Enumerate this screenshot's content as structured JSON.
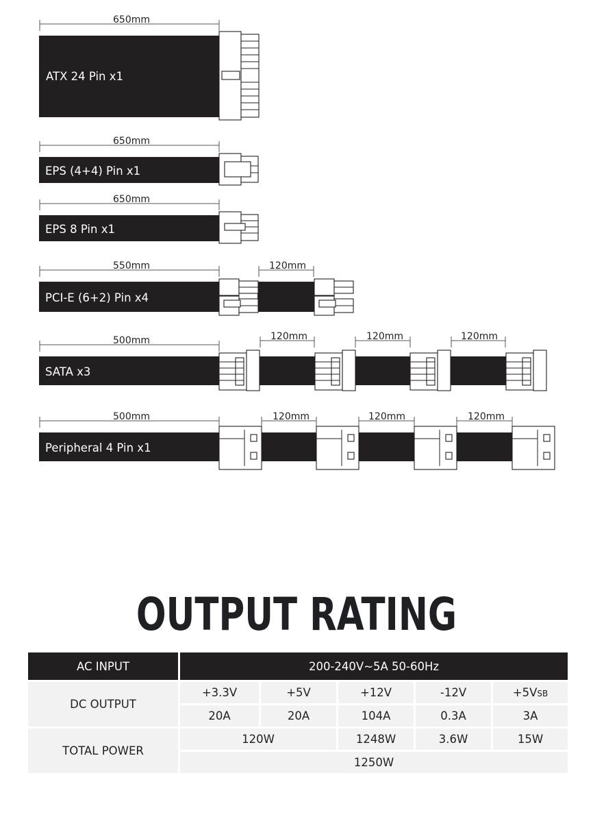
{
  "cables": [
    {
      "label": "ATX 24 Pin x1",
      "main_length": "650mm"
    },
    {
      "label": "EPS (4+4) Pin x1",
      "main_length": "650mm"
    },
    {
      "label": "EPS 8 Pin x1",
      "main_length": "650mm"
    },
    {
      "label": "PCI-E (6+2) Pin x4",
      "main_length": "550mm",
      "segments": [
        "120mm"
      ]
    },
    {
      "label": "SATA x3",
      "main_length": "500mm",
      "segments": [
        "120mm",
        "120mm",
        "120mm"
      ]
    },
    {
      "label": "Peripheral 4 Pin x1",
      "main_length": "500mm",
      "segments": [
        "120mm",
        "120mm",
        "120mm"
      ]
    }
  ],
  "output_rating": {
    "title": "OUTPUT RATING",
    "ac_input_label": "AC INPUT",
    "ac_input_value": "200-240V~5A 50-60Hz",
    "dc_output_label": "DC OUTPUT",
    "rails": [
      "+3.3V",
      "+5V",
      "+12V",
      "-12V"
    ],
    "rail_5vsb_main": "+5V",
    "rail_5vsb_sub": "SB",
    "currents": [
      "20A",
      "20A",
      "104A",
      "0.3A",
      "3A"
    ],
    "total_power_label": "TOTAL POWER",
    "combined_3v3_5v": "120W",
    "power_12v": "1248W",
    "power_neg12v": "3.6W",
    "power_5vsb": "15W",
    "total": "1250W"
  },
  "colors": {
    "cable": "#231f20",
    "table_header": "#231f20",
    "table_cell": "#f2f2f2"
  }
}
